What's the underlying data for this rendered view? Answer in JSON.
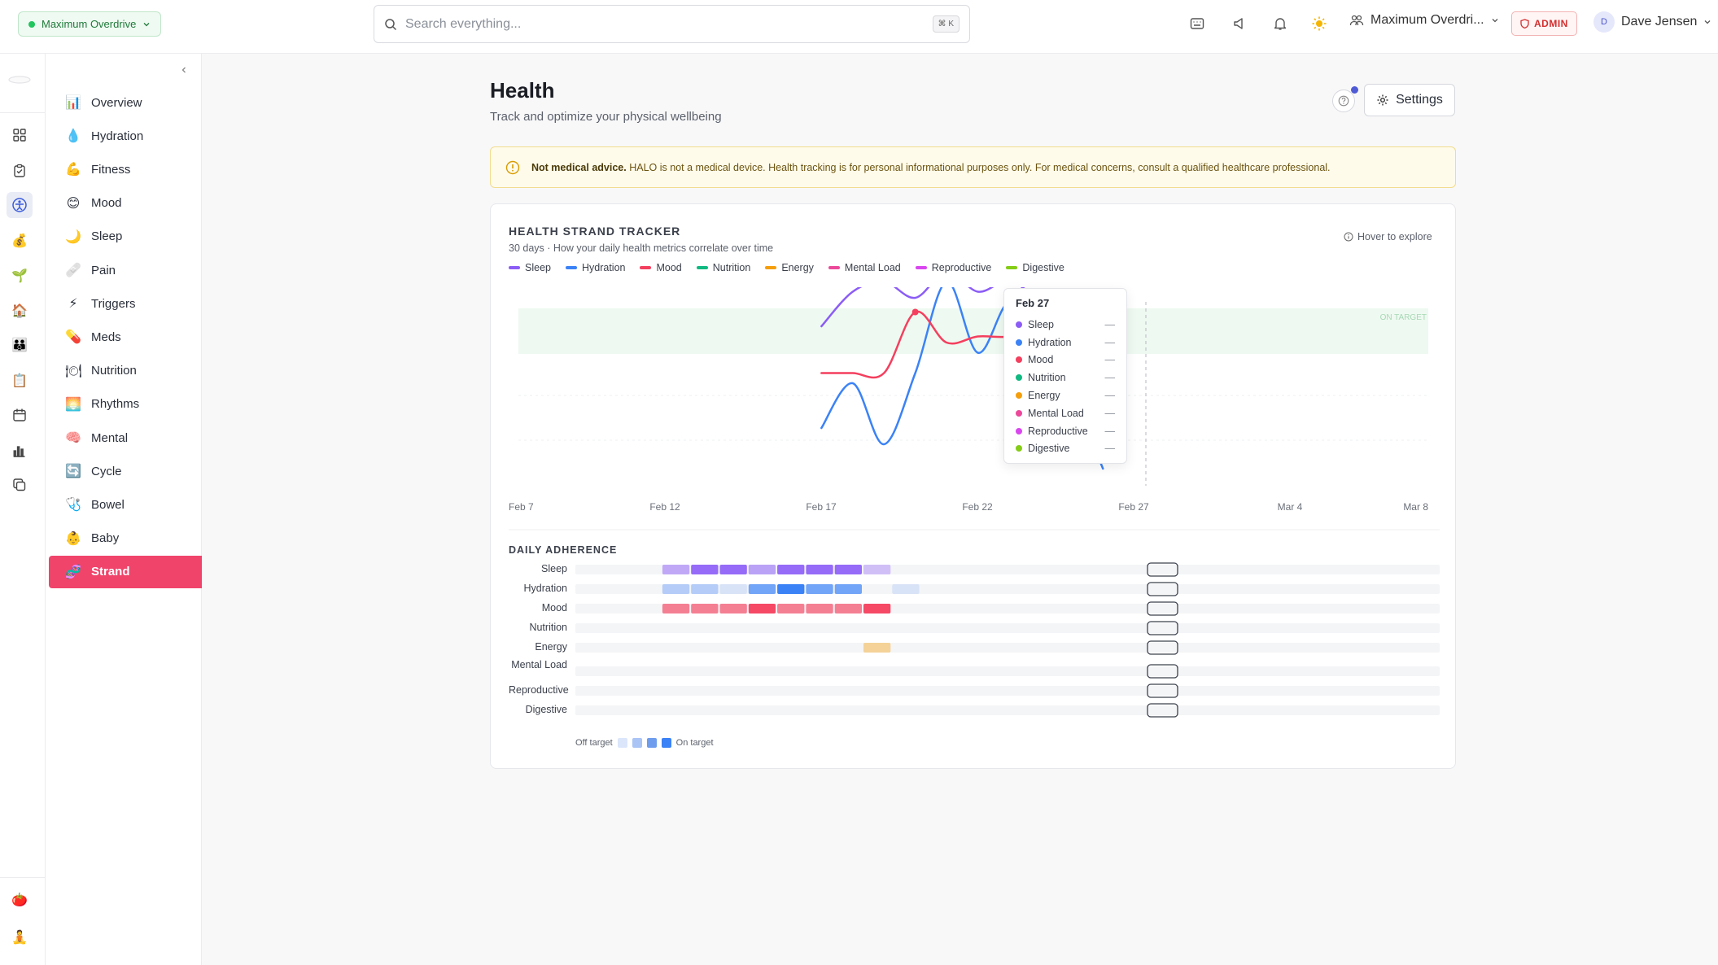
{
  "topbar": {
    "workspace": "Maximum Overdrive",
    "search_placeholder": "Search everything...",
    "search_shortcut": "⌘ K",
    "org_name": "Maximum Overdri...",
    "admin_label": "ADMIN",
    "user_initial": "D",
    "user_name": "Dave Jensen"
  },
  "sidebar": {
    "items": [
      {
        "label": "Overview",
        "icon": "📊"
      },
      {
        "label": "Hydration",
        "icon": "💧"
      },
      {
        "label": "Fitness",
        "icon": "💪"
      },
      {
        "label": "Mood",
        "icon": "😊"
      },
      {
        "label": "Sleep",
        "icon": "🌙"
      },
      {
        "label": "Pain",
        "icon": "🩹"
      },
      {
        "label": "Triggers",
        "icon": "⚡"
      },
      {
        "label": "Meds",
        "icon": "💊"
      },
      {
        "label": "Nutrition",
        "icon": "🍽"
      },
      {
        "label": "Rhythms",
        "icon": "🌅"
      },
      {
        "label": "Mental",
        "icon": "🧠"
      },
      {
        "label": "Cycle",
        "icon": "🔄"
      },
      {
        "label": "Bowel",
        "icon": "🩺"
      },
      {
        "label": "Baby",
        "icon": "👶"
      },
      {
        "label": "Strand",
        "icon": "🧬"
      }
    ],
    "active": "Strand"
  },
  "page": {
    "title": "Health",
    "subtitle": "Track and optimize your physical wellbeing",
    "settings_label": "Settings",
    "notice_bold": "Not medical advice.",
    "notice_text": "HALO is not a medical device. Health tracking is for personal informational purposes only. For medical concerns, consult a qualified healthcare professional."
  },
  "tracker": {
    "title": "HEALTH STRAND TRACKER",
    "subtitle": "30 days · How your daily health metrics correlate over time",
    "hover_hint": "Hover to explore",
    "target_band_label": "ON TARGET",
    "tooltip_date": "Feb 27",
    "tooltip_value": "—"
  },
  "colors": {
    "Sleep": "#8b5cf6",
    "Hydration": "#3b82f6",
    "Mood": "#f43f5e",
    "Nutrition": "#10b981",
    "Energy": "#f59e0b",
    "Mental Load": "#ec4899",
    "Reproductive": "#d946ef",
    "Digestive": "#84cc16"
  },
  "chart_data": {
    "type": "line",
    "x_ticks": [
      "Feb 7",
      "Feb 12",
      "Feb 17",
      "Feb 22",
      "Feb 27",
      "Mar 4",
      "Mar 8"
    ],
    "series": [
      {
        "name": "Sleep",
        "x": [
          10,
          11,
          12,
          13,
          14,
          15,
          16,
          17,
          18
        ],
        "y": [
          0.78,
          0.95,
          1.0,
          0.92,
          1.05,
          0.95,
          1.0,
          0.88,
          0.55
        ]
      },
      {
        "name": "Hydration",
        "x": [
          10,
          11,
          12,
          13,
          14,
          15,
          16,
          17,
          18,
          19
        ],
        "y": [
          0.28,
          0.5,
          0.2,
          0.55,
          1.0,
          0.65,
          0.9,
          0.75,
          0.45,
          0.08
        ]
      },
      {
        "name": "Mood",
        "x": [
          10,
          11,
          12,
          13,
          14,
          15,
          16,
          17,
          18
        ],
        "y": [
          0.55,
          0.55,
          0.55,
          0.85,
          0.7,
          0.73,
          0.73,
          0.78,
          0.85
        ]
      },
      {
        "name": "Nutrition",
        "x": [],
        "y": []
      },
      {
        "name": "Energy",
        "x": [],
        "y": []
      },
      {
        "name": "Mental Load",
        "x": [],
        "y": []
      },
      {
        "name": "Reproductive",
        "x": [],
        "y": []
      },
      {
        "name": "Digestive",
        "x": [],
        "y": []
      }
    ]
  },
  "adherence": {
    "title": "DAILY ADHERENCE",
    "rows": [
      {
        "label": "Sleep",
        "cells": {
          "3": 0.5,
          "4": 0.9,
          "5": 0.9,
          "6": 0.55,
          "7": 0.9,
          "8": 0.9,
          "9": 0.9,
          "10": 0.35
        }
      },
      {
        "label": "Hydration",
        "cells": {
          "3": 0.35,
          "4": 0.35,
          "5": 0.15,
          "6": 0.7,
          "7": 1.0,
          "8": 0.7,
          "9": 0.7,
          "11": 0.15
        }
      },
      {
        "label": "Mood",
        "cells": {
          "3": 0.65,
          "4": 0.65,
          "5": 0.65,
          "6": 0.95,
          "7": 0.65,
          "8": 0.65,
          "9": 0.65,
          "10": 0.95
        }
      },
      {
        "label": "Nutrition",
        "cells": {}
      },
      {
        "label": "Energy",
        "cells": {
          "10": 0.4
        }
      },
      {
        "label": "Mental Load",
        "cells": {}
      },
      {
        "label": "Reproductive",
        "cells": {}
      },
      {
        "label": "Digestive",
        "cells": {}
      }
    ],
    "legend_off": "Off target",
    "legend_on": "On target"
  }
}
